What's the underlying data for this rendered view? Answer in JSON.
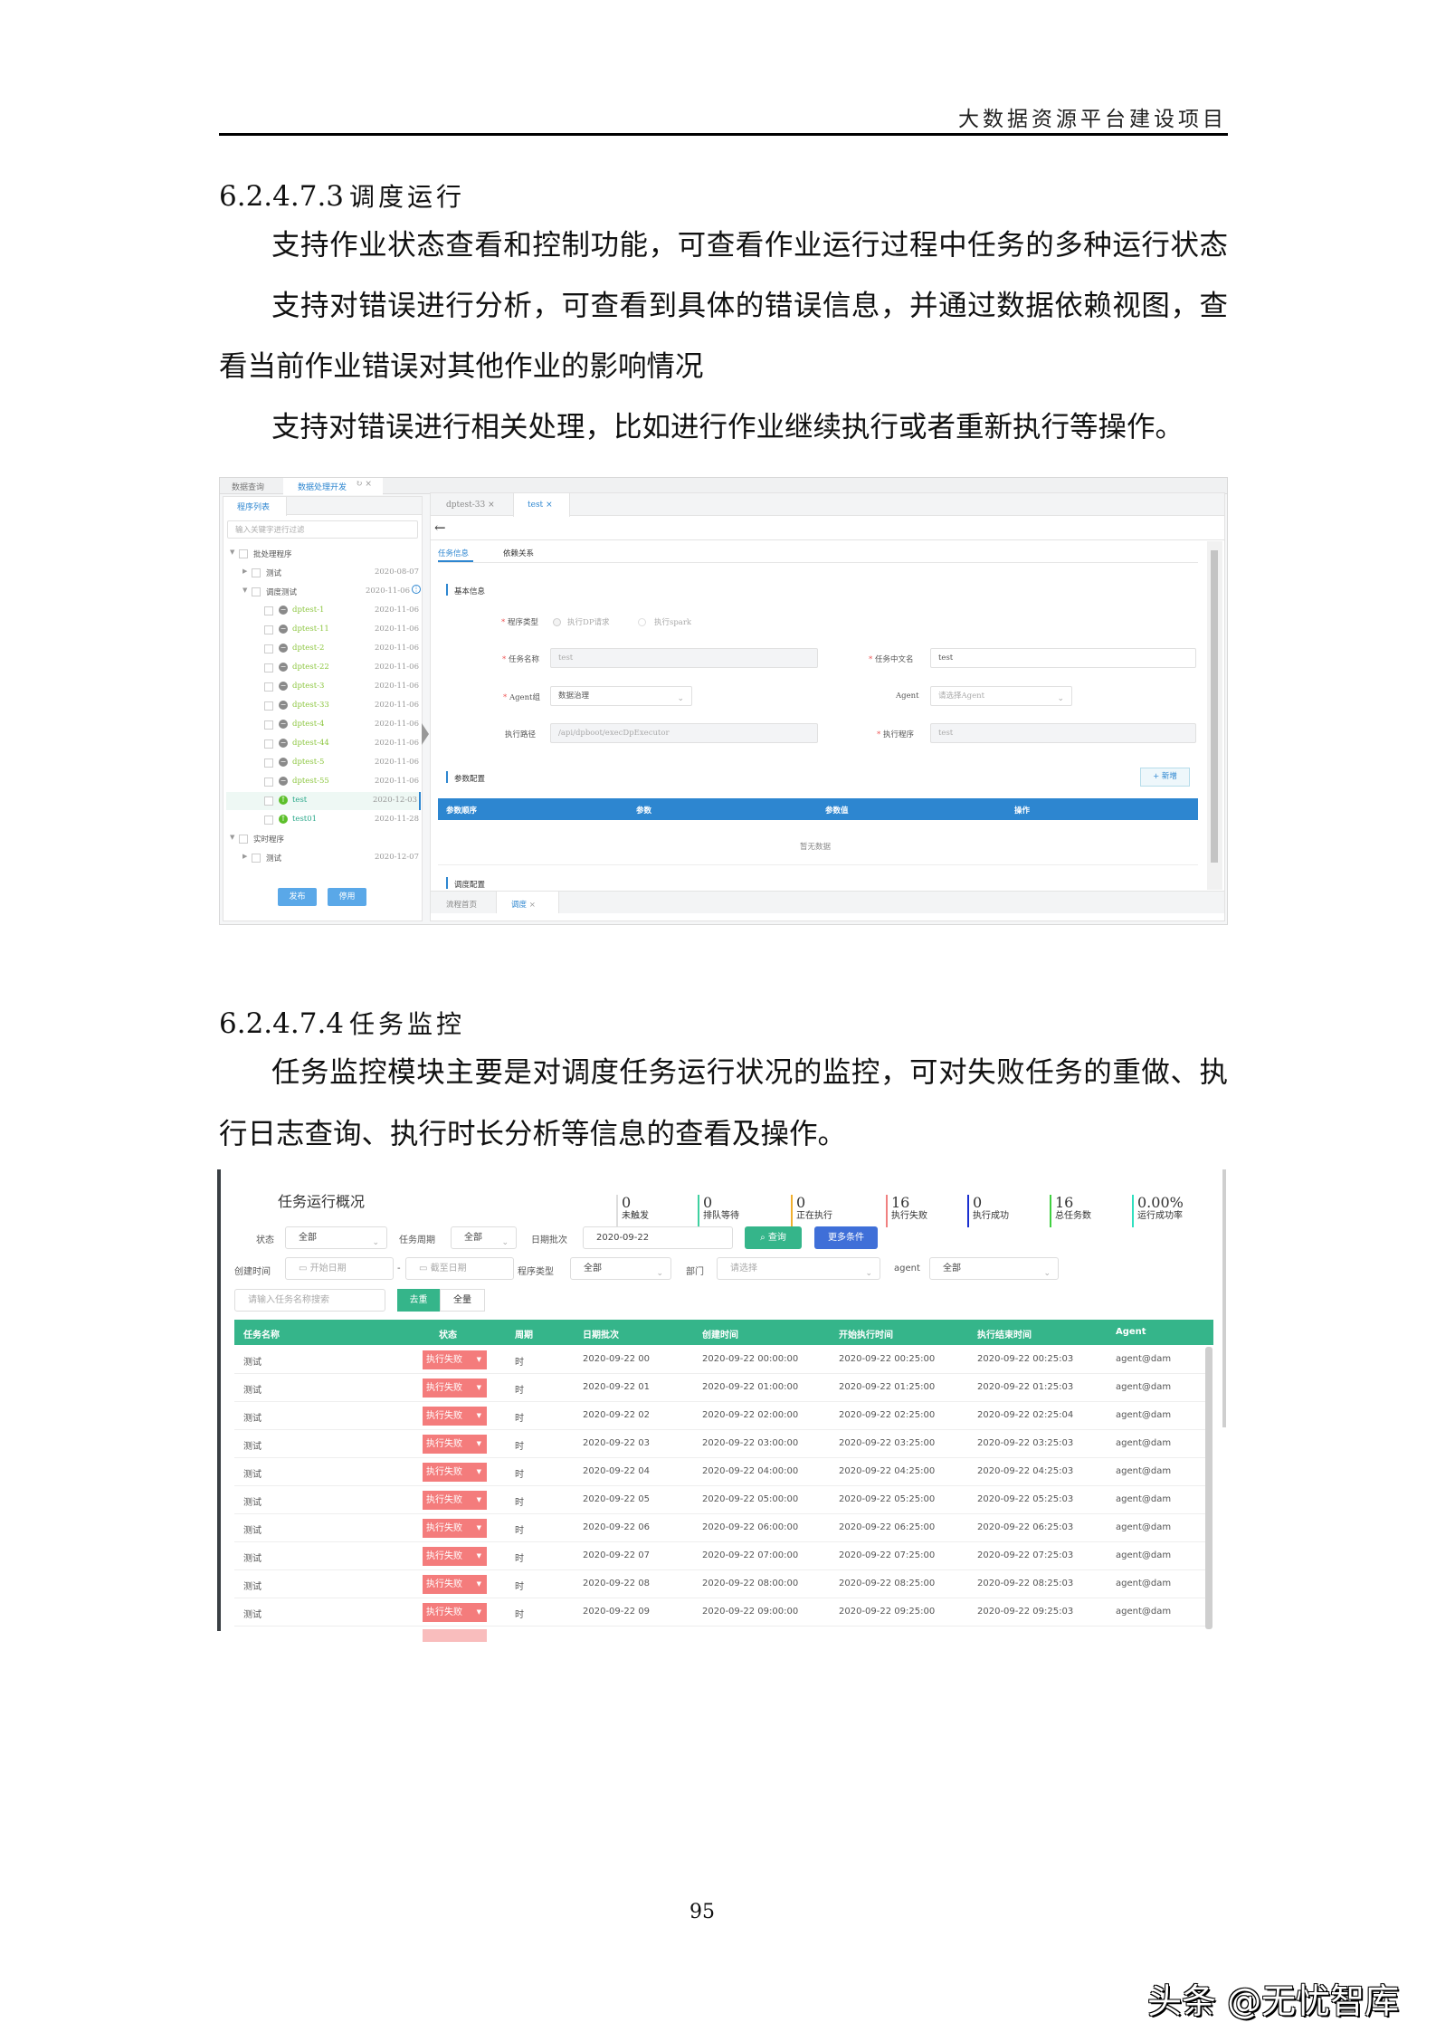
{
  "header": {
    "title": "大数据资源平台建设项目"
  },
  "section1": {
    "number": "6.2.4.7.3",
    "title": "调度运行",
    "lines": [
      {
        "text": "支持作业状态查看和控制功能，可查看作业运行过程中任务的多种运行状态",
        "indent": true,
        "justify": true
      },
      {
        "text": "支持对错误进行分析，可查看到具体的错误信息，并通过数据依赖视图，查",
        "indent": true,
        "justify": true
      },
      {
        "text": "看当前作业错误对其他作业的影响情况",
        "indent": false,
        "justify": false
      },
      {
        "text": "支持对错误进行相关处理，比如进行作业继续执行或者重新执行等操作。",
        "indent": true,
        "justify": false
      }
    ]
  },
  "shot1": {
    "top_tabs": [
      {
        "label": "数据查询"
      },
      {
        "label": "数据处理开发"
      }
    ],
    "left_tab": "程序列表",
    "filter_placeholder": "输入关键字进行过滤",
    "tree": [
      {
        "label": "批处理程序",
        "date": "",
        "level": 0,
        "type": "folder",
        "open": true
      },
      {
        "label": "测试",
        "date": "2020-08-07",
        "level": 1,
        "type": "folder",
        "open": false
      },
      {
        "label": "调度测试",
        "date": "2020-11-06",
        "level": 1,
        "type": "folder",
        "open": true
      },
      {
        "label": "dptest-1",
        "date": "2020-11-06",
        "level": 2,
        "type": "stopped"
      },
      {
        "label": "dptest-11",
        "date": "2020-11-06",
        "level": 2,
        "type": "stopped"
      },
      {
        "label": "dptest-2",
        "date": "2020-11-06",
        "level": 2,
        "type": "stopped"
      },
      {
        "label": "dptest-22",
        "date": "2020-11-06",
        "level": 2,
        "type": "stopped"
      },
      {
        "label": "dptest-3",
        "date": "2020-11-06",
        "level": 2,
        "type": "stopped"
      },
      {
        "label": "dptest-33",
        "date": "2020-11-06",
        "level": 2,
        "type": "stopped"
      },
      {
        "label": "dptest-4",
        "date": "2020-11-06",
        "level": 2,
        "type": "stopped"
      },
      {
        "label": "dptest-44",
        "date": "2020-11-06",
        "level": 2,
        "type": "stopped"
      },
      {
        "label": "dptest-5",
        "date": "2020-11-06",
        "level": 2,
        "type": "stopped"
      },
      {
        "label": "dptest-55",
        "date": "2020-11-06",
        "level": 2,
        "type": "stopped"
      },
      {
        "label": "test",
        "date": "2020-12-03",
        "level": 2,
        "type": "published",
        "selected": true
      },
      {
        "label": "test01",
        "date": "2020-11-28",
        "level": 2,
        "type": "published"
      },
      {
        "label": "实时程序",
        "date": "",
        "level": 0,
        "type": "folder",
        "open": true
      },
      {
        "label": "测试",
        "date": "2020-12-07",
        "level": 1,
        "type": "folder",
        "open": false
      }
    ],
    "publish_btn": "发布",
    "disable_btn": "停用",
    "editor_tabs": [
      {
        "label": "dptest-33"
      },
      {
        "label": "test"
      }
    ],
    "sub_tabs": [
      "任务信息",
      "依赖关系"
    ],
    "basic_info": "基本信息",
    "program_type_label": "程序类型",
    "radio_dp": "执行DP请求",
    "radio_spark": "执行spark",
    "task_name_label": "任务名称",
    "task_name_value": "test",
    "task_cn_label": "任务中文名",
    "task_cn_value": "test",
    "agent_group_label": "Agent组",
    "agent_group_value": "数据治理",
    "agent_label": "Agent",
    "agent_placeholder": "请选择Agent",
    "exec_path_label": "执行路径",
    "exec_path_value": "/api/dpboot/execDpExecutor",
    "exec_program_label": "执行程序",
    "exec_program_value": "test",
    "param_config": "参数配置",
    "add_btn": "+ 新增",
    "param_columns": [
      "参数顺序",
      "参数",
      "参数值",
      "操作"
    ],
    "empty_text": "暂无数据",
    "schedule_config": "调度配置",
    "bottom_tabs": [
      "流程首页",
      "调度"
    ],
    "colors": {
      "primary": "#2d86d0",
      "green_item": "#8cc63f"
    }
  },
  "section2": {
    "number": "6.2.4.7.4",
    "title": "任务监控",
    "lines": [
      {
        "text": "任务监控模块主要是对调度任务运行状况的监控，可对失败任务的重做、执",
        "indent": true,
        "justify": true
      },
      {
        "text": "行日志查询、执行时长分析等信息的查看及操作。",
        "indent": false,
        "justify": false
      }
    ]
  },
  "shot2": {
    "title": "任务运行概况",
    "stats": [
      {
        "value": "0",
        "label": "未触发",
        "color": "#dddddd"
      },
      {
        "value": "0",
        "label": "排队等待",
        "color": "#3fd0a0"
      },
      {
        "value": "0",
        "label": "正在执行",
        "color": "#f0b030"
      },
      {
        "value": "16",
        "label": "执行失败",
        "color": "#f08080"
      },
      {
        "value": "0",
        "label": "执行成功",
        "color": "#1a2fd0"
      },
      {
        "value": "16",
        "label": "总任务数",
        "color": "#40d040"
      },
      {
        "value": "0.00%",
        "label": "运行成功率",
        "color": "#30e0c0"
      }
    ],
    "filters": {
      "status_label": "状态",
      "status_value": "全部",
      "cycle_label": "任务周期",
      "cycle_value": "全部",
      "batch_label": "日期批次",
      "batch_value": "2020-09-22",
      "query_btn": "查询",
      "more_btn": "更多条件",
      "created_label": "创建时间",
      "start_placeholder": "开始日期",
      "end_placeholder": "截至日期",
      "ptype_label": "程序类型",
      "ptype_value": "全部",
      "dept_label": "部门",
      "dept_placeholder": "请选择",
      "agent_label": "agent",
      "agent_value": "全部",
      "search_placeholder": "请输入任务名称搜索",
      "dedup_btn": "去重",
      "full_btn": "全量"
    },
    "columns": [
      "任务名称",
      "状态",
      "周期",
      "日期批次",
      "创建时间",
      "开始执行时间",
      "执行结束时间",
      "Agent"
    ],
    "rows": [
      [
        "测试",
        "执行失败",
        "时",
        "2020-09-22 00",
        "2020-09-22 00:00:00",
        "2020-09-22 00:25:00",
        "2020-09-22 00:25:03",
        "agent@dam"
      ],
      [
        "测试",
        "执行失败",
        "时",
        "2020-09-22 01",
        "2020-09-22 01:00:00",
        "2020-09-22 01:25:00",
        "2020-09-22 01:25:03",
        "agent@dam"
      ],
      [
        "测试",
        "执行失败",
        "时",
        "2020-09-22 02",
        "2020-09-22 02:00:00",
        "2020-09-22 02:25:00",
        "2020-09-22 02:25:04",
        "agent@dam"
      ],
      [
        "测试",
        "执行失败",
        "时",
        "2020-09-22 03",
        "2020-09-22 03:00:00",
        "2020-09-22 03:25:00",
        "2020-09-22 03:25:03",
        "agent@dam"
      ],
      [
        "测试",
        "执行失败",
        "时",
        "2020-09-22 04",
        "2020-09-22 04:00:00",
        "2020-09-22 04:25:00",
        "2020-09-22 04:25:03",
        "agent@dam"
      ],
      [
        "测试",
        "执行失败",
        "时",
        "2020-09-22 05",
        "2020-09-22 05:00:00",
        "2020-09-22 05:25:00",
        "2020-09-22 05:25:03",
        "agent@dam"
      ],
      [
        "测试",
        "执行失败",
        "时",
        "2020-09-22 06",
        "2020-09-22 06:00:00",
        "2020-09-22 06:25:00",
        "2020-09-22 06:25:03",
        "agent@dam"
      ],
      [
        "测试",
        "执行失败",
        "时",
        "2020-09-22 07",
        "2020-09-22 07:00:00",
        "2020-09-22 07:25:00",
        "2020-09-22 07:25:03",
        "agent@dam"
      ],
      [
        "测试",
        "执行失败",
        "时",
        "2020-09-22 08",
        "2020-09-22 08:00:00",
        "2020-09-22 08:25:00",
        "2020-09-22 08:25:03",
        "agent@dam"
      ],
      [
        "测试",
        "执行失败",
        "时",
        "2020-09-22 09",
        "2020-09-22 09:00:00",
        "2020-09-22 09:25:00",
        "2020-09-22 09:25:03",
        "agent@dam"
      ]
    ],
    "colors": {
      "header": "#35b58a",
      "fail": "#f47c7c",
      "more": "#3f6fd8"
    }
  },
  "page_number": "95",
  "watermark": "头条 @无忧智库"
}
